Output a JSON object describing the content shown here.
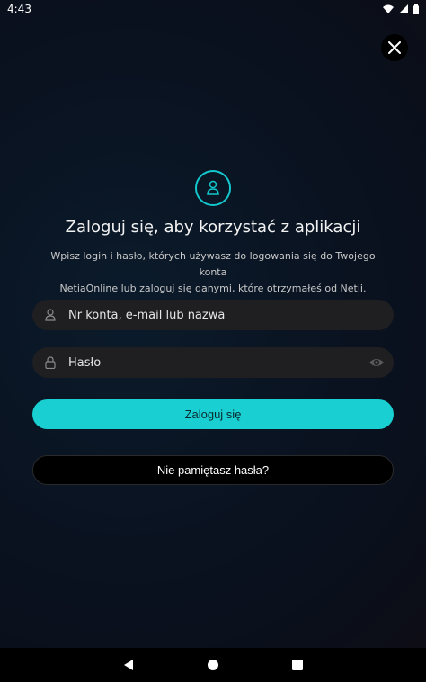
{
  "status": {
    "time": "4:43"
  },
  "login": {
    "title": "Zaloguj się, aby korzystać z aplikacji",
    "subtitle_line1": "Wpisz login i hasło, których używasz do logowania się do Twojego konta",
    "subtitle_line2": "NetiaOnline lub zaloguj się danymi, które otrzymałeś od Netii.",
    "username_placeholder": "Nr konta, e-mail lub nazwa",
    "password_placeholder": "Hasło",
    "submit_label": "Zaloguj się",
    "forgot_label": "Nie pamiętasz hasła?"
  },
  "icons": {
    "close": "close-icon",
    "user": "user-icon",
    "lock": "lock-icon",
    "eye": "eye-icon"
  },
  "colors": {
    "accent": "#19cfd1"
  }
}
